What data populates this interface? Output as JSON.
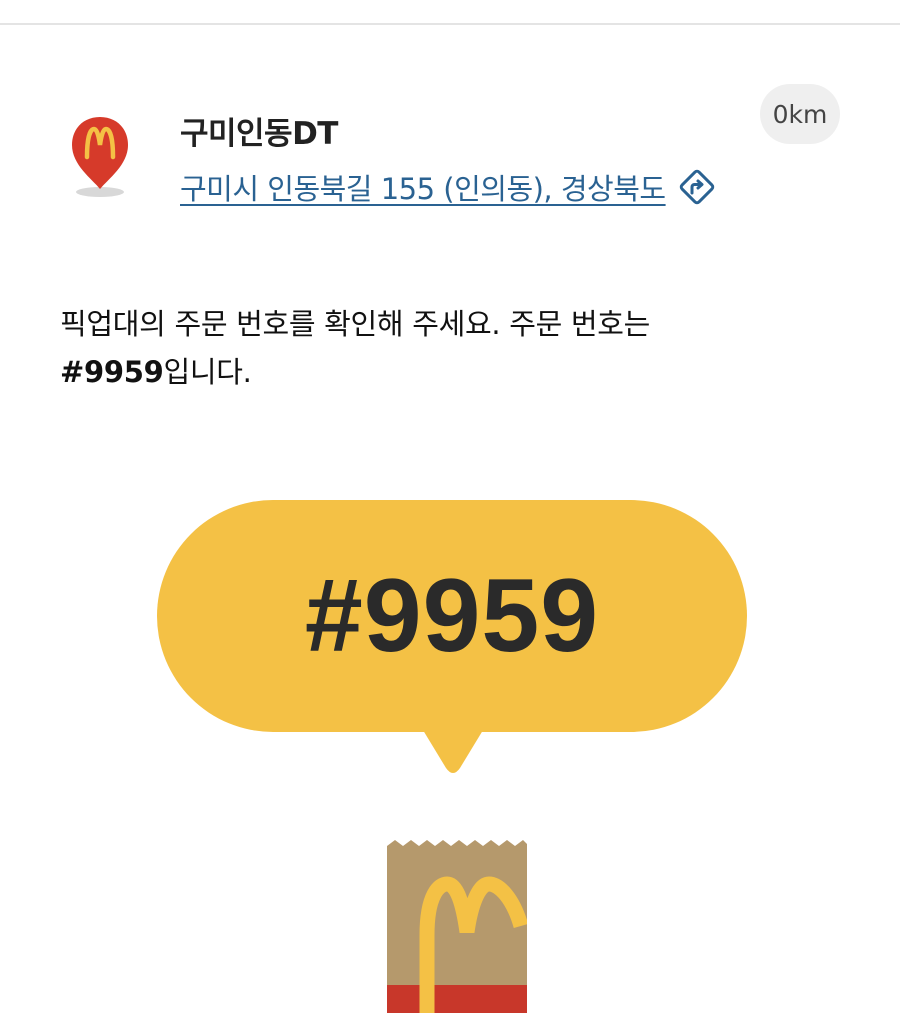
{
  "store": {
    "name": "구미인동DT",
    "address": "구미시 인동북길 155 (인의동), 경상북도",
    "distance": "0km",
    "pin_icon": "mcdonalds-map-pin-icon",
    "directions_icon": "directions-icon"
  },
  "instruction": {
    "text": "픽업대의 주문 번호를 확인해 주세요. 주문 번호는",
    "number": "#9959",
    "suffix": "입니다."
  },
  "order": {
    "number": "#9959"
  },
  "illustration": {
    "icon": "mcdonalds-paper-bag-icon"
  },
  "colors": {
    "brand_yellow": "#f4c145",
    "brand_red": "#da291c",
    "link_blue": "#2a6292",
    "bag_brown": "#b5996c"
  }
}
